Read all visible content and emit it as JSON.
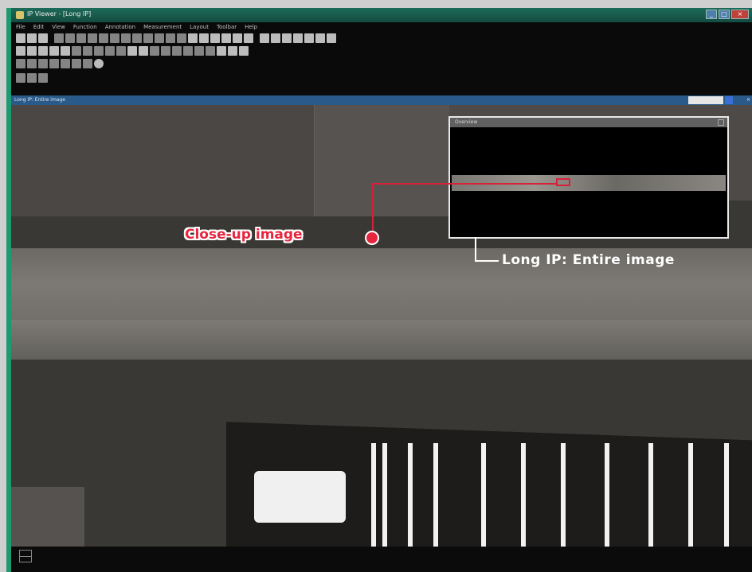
{
  "window": {
    "title": "IP Viewer - [Long IP]",
    "buttons": {
      "minimize": "_",
      "maximize": "□",
      "close": "×"
    }
  },
  "menubar": {
    "items": [
      "File",
      "Edit",
      "View",
      "Function",
      "Annotation",
      "Measurement",
      "Layout",
      "Toolbar",
      "Help"
    ]
  },
  "statusbar": {
    "path": "Long IP: Entire image",
    "zoom_label": "×"
  },
  "overview": {
    "title": "Overview",
    "caption": "Long IP:  Entire image"
  },
  "callouts": {
    "closeup": "Close-up image",
    "long_ip": "Long IP:  Entire image"
  },
  "colors": {
    "accent": "#e6263f",
    "window_border": "#1f9a70",
    "toolbar_bg": "#0a0a0a"
  }
}
